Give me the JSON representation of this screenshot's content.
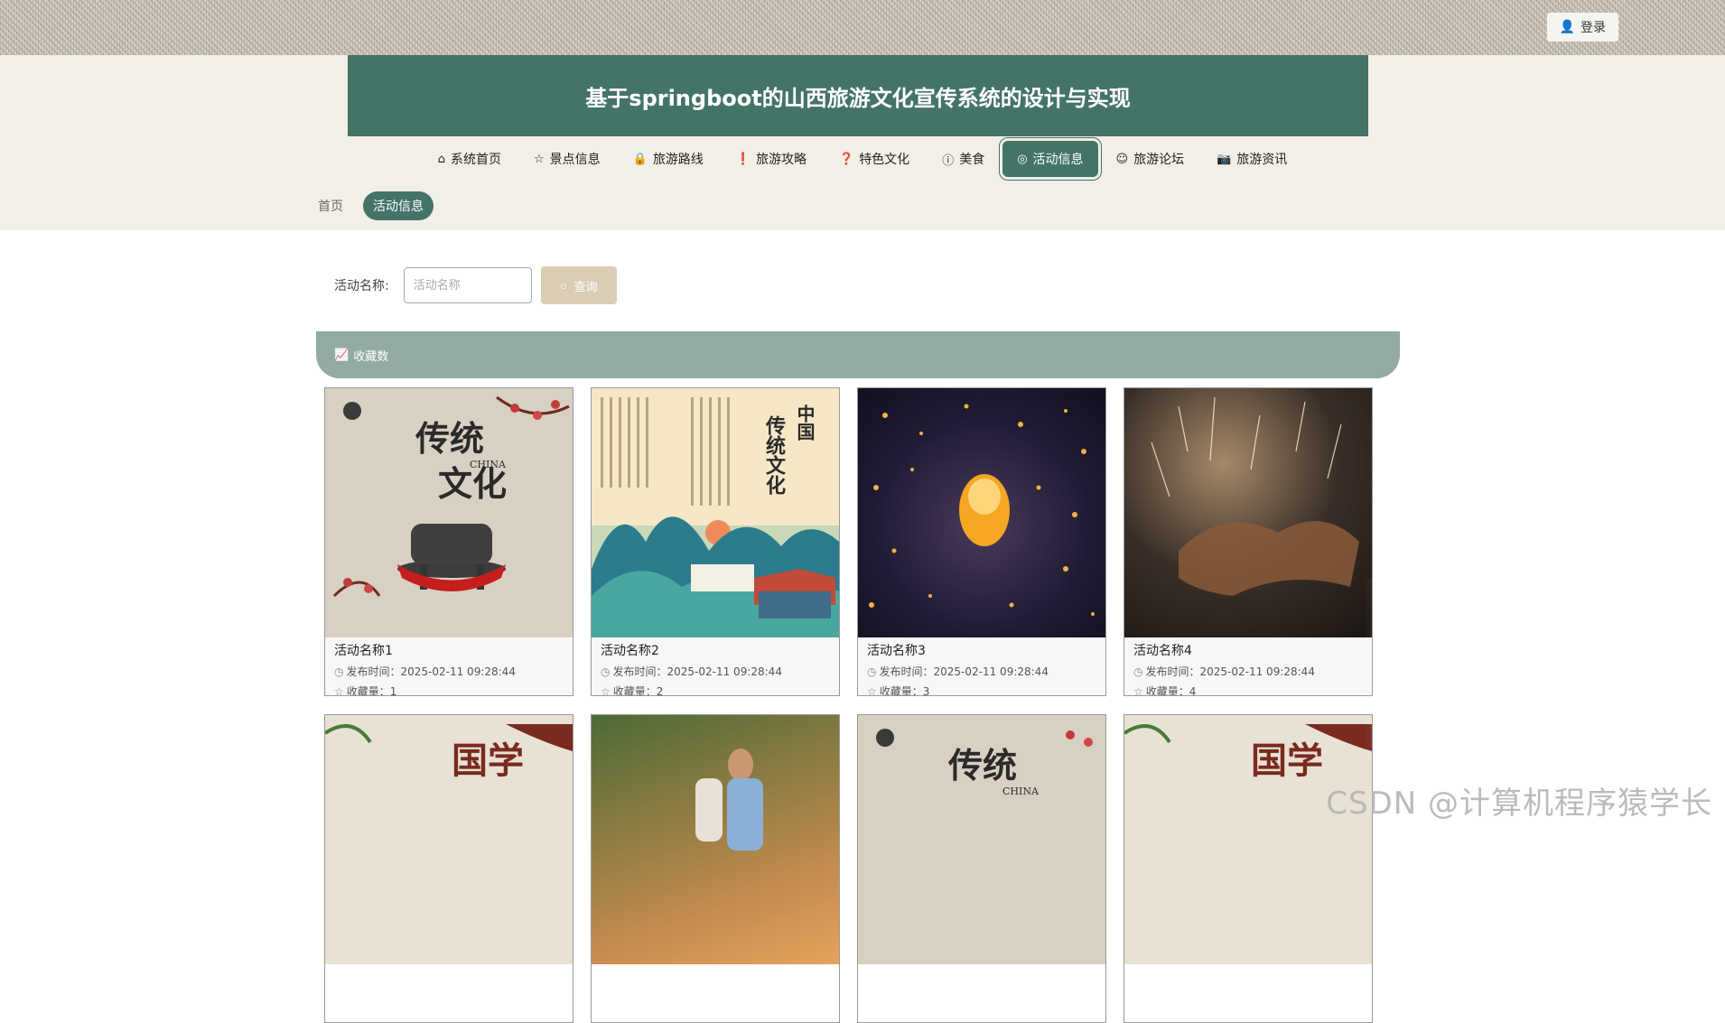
{
  "header": {
    "login_label": "登录"
  },
  "site": {
    "title": "基于springboot的山西旅游文化宣传系统的设计与实现"
  },
  "nav": [
    {
      "icon": "home-icon",
      "label": "系统首页"
    },
    {
      "icon": "star-icon",
      "label": "景点信息"
    },
    {
      "icon": "bag-icon",
      "label": "旅游路线"
    },
    {
      "icon": "info-icon",
      "label": "旅游攻略"
    },
    {
      "icon": "question-icon",
      "label": "特色文化"
    },
    {
      "icon": "info-italic-icon",
      "label": "美食"
    },
    {
      "icon": "target-icon",
      "label": "活动信息",
      "active": true
    },
    {
      "icon": "smile-icon",
      "label": "旅游论坛"
    },
    {
      "icon": "camera-icon",
      "label": "旅游资讯"
    }
  ],
  "breadcrumb": {
    "home": "首页",
    "current": "活动信息"
  },
  "search": {
    "label": "活动名称:",
    "placeholder": "活动名称",
    "button": "查询"
  },
  "sort_bar": {
    "label": "收藏数"
  },
  "card_labels": {
    "publish_prefix": "发布时间：",
    "fav_prefix": "收藏量："
  },
  "cards": [
    {
      "name": "活动名称1",
      "time": "2025-02-11 09:28:44",
      "favs": "1",
      "image": "传统文化 poster"
    },
    {
      "name": "活动名称2",
      "time": "2025-02-11 09:28:44",
      "favs": "2",
      "image": "中国传统文化 poster"
    },
    {
      "name": "活动名称3",
      "time": "2025-02-11 09:28:44",
      "favs": "3",
      "image": "sky lanterns"
    },
    {
      "name": "活动名称4",
      "time": "2025-02-11 09:28:44",
      "favs": "4",
      "image": "iron flower fireworks"
    },
    {
      "name": "",
      "time": "",
      "favs": "",
      "image": "国学文化 poster"
    },
    {
      "name": "",
      "time": "",
      "favs": "",
      "image": "couple photo"
    },
    {
      "name": "",
      "time": "",
      "favs": "",
      "image": "传统文化 poster"
    },
    {
      "name": "",
      "time": "",
      "favs": "",
      "image": "国学文化 poster"
    }
  ],
  "poster_text": {
    "chuantong": "传统",
    "wenhua": "文化",
    "china": "CHINA",
    "zhongguo": "中国",
    "guoxue": "国学",
    "wen": "文"
  },
  "watermark": "CSDN @计算机程序猿学长",
  "colors": {
    "primary": "#447468",
    "sortbar": "#93aba2",
    "button": "#d9cdb5",
    "band": "#f1efe6"
  }
}
